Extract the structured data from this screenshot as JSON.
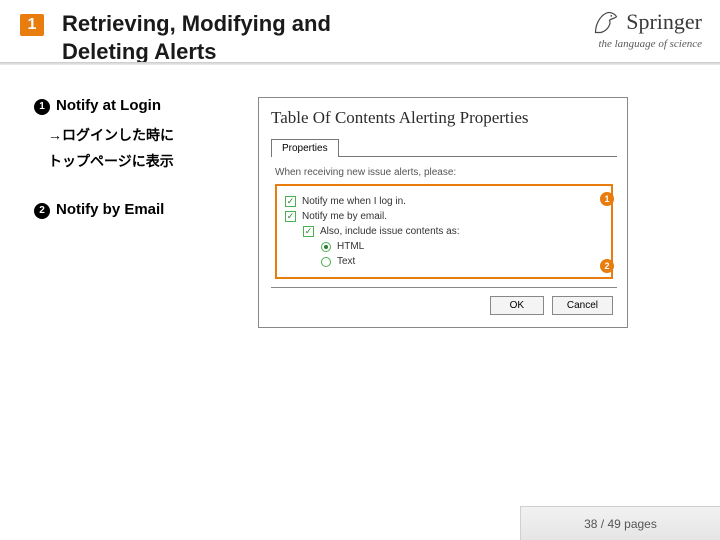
{
  "header": {
    "slide_number": "1",
    "title": "Retrieving, Modifying and Deleting Alerts"
  },
  "brand": {
    "name": "Springer",
    "tagline": "the language of science"
  },
  "left": {
    "b1_num": "1",
    "b1_text": "Notify at Login",
    "b1_sub1": "→ログインした時に",
    "b1_sub2": "トップページに表示",
    "b2_num": "2",
    "b2_text": "Notify by Email"
  },
  "panel": {
    "title": "Table Of Contents Alerting Properties",
    "tab": "Properties",
    "section_label": "When receiving new issue alerts, please:",
    "opt_login": "Notify me when I log in.",
    "opt_email": "Notify me by email.",
    "opt_include": "Also, include issue contents as:",
    "opt_html": "HTML",
    "opt_text": "Text",
    "callout1": "1",
    "callout2": "2",
    "btn_ok": "OK",
    "btn_cancel": "Cancel"
  },
  "footer": {
    "page": "38 / 49 pages"
  }
}
